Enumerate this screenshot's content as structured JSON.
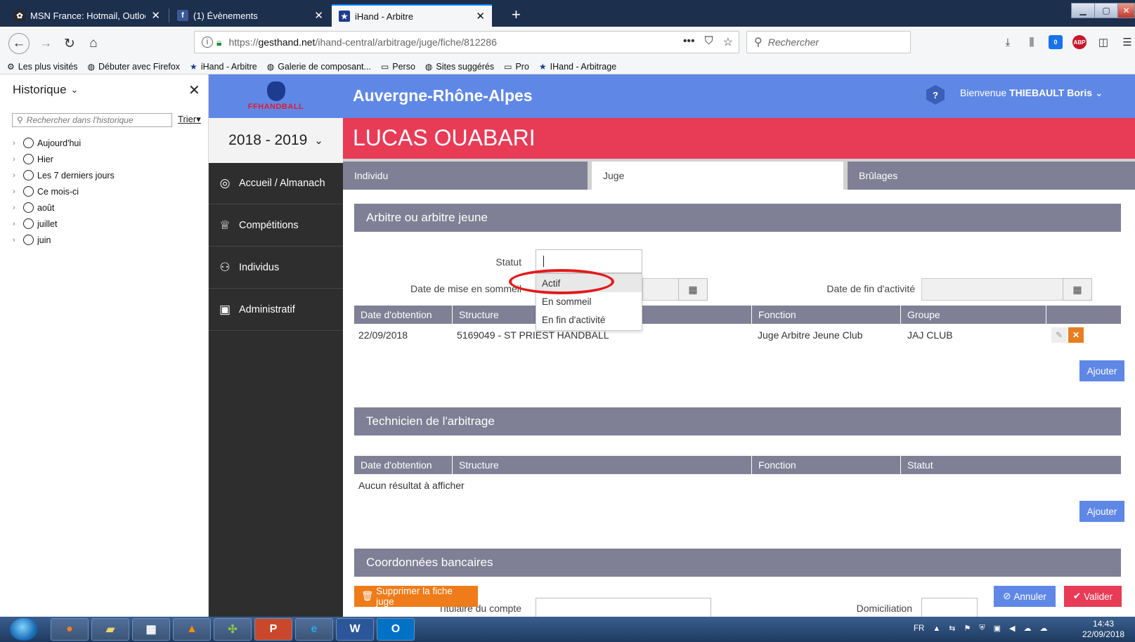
{
  "browser": {
    "tabs": [
      {
        "title": "MSN France: Hotmail, Outlook,",
        "favicon": "msn-butterfly-icon"
      },
      {
        "title": "(1) Évènements",
        "favicon": "facebook-icon"
      },
      {
        "title": "iHand - Arbitre",
        "favicon": "ffhandball-icon",
        "active": true
      }
    ],
    "url": {
      "protocol": "https://",
      "host": "gesthand.net",
      "path": "/ihand-central/arbitrage/juge/fiche/812286"
    },
    "search_placeholder": "Rechercher",
    "notification_count": "0",
    "adblock_label": "ABP",
    "bookmarks": [
      {
        "label": "Les plus visités",
        "icon": "gear-icon"
      },
      {
        "label": "Débuter avec Firefox",
        "icon": "globe-icon"
      },
      {
        "label": "iHand - Arbitre",
        "icon": "ffhandball-icon"
      },
      {
        "label": "Galerie de composant...",
        "icon": "globe-icon"
      },
      {
        "label": "Perso",
        "icon": "folder-icon"
      },
      {
        "label": "Sites suggérés",
        "icon": "globe-icon"
      },
      {
        "label": "Pro",
        "icon": "folder-icon"
      },
      {
        "label": "IHand - Arbitrage",
        "icon": "ffhandball-icon"
      }
    ]
  },
  "history": {
    "title": "Historique",
    "search_placeholder": "Rechercher dans l'historique",
    "sort_label": "Trier",
    "items": [
      "Aujourd'hui",
      "Hier",
      "Les 7 derniers jours",
      "Ce mois-ci",
      "août",
      "juillet",
      "juin"
    ]
  },
  "app": {
    "logo_text": "FFHANDBALL",
    "season": "2018 - 2019",
    "nav": [
      {
        "label": "Accueil / Almanach",
        "icon": "compass-icon"
      },
      {
        "label": "Compétitions",
        "icon": "trophy-icon"
      },
      {
        "label": "Individus",
        "icon": "user-icon"
      },
      {
        "label": "Administratif",
        "icon": "briefcase-icon"
      }
    ],
    "region": "Auvergne-Rhône-Alpes",
    "help_label": "?",
    "welcome_prefix": "Bienvenue",
    "welcome_user": "THIEBAULT Boris",
    "person_name": "LUCAS OUABARI",
    "tabs": [
      "Individu",
      "Juge",
      "Brûlages"
    ],
    "active_tab": "Juge"
  },
  "form": {
    "section1_title": "Arbitre ou arbitre jeune",
    "statut_label": "Statut",
    "statut_value": "",
    "statut_options": [
      "Actif",
      "En sommeil",
      "En fin d'activité"
    ],
    "date_sommeil_label": "Date de mise en sommeil",
    "date_fin_label": "Date de fin d'activité",
    "table1": {
      "headers": [
        "Date d'obtention",
        "Structure",
        "Fonction",
        "Groupe"
      ],
      "rows": [
        {
          "date": "22/09/2018",
          "structure": "5169049 - ST PRIEST HANDBALL",
          "fonction": "Juge Arbitre Jeune Club",
          "groupe": "JAJ CLUB"
        }
      ]
    },
    "add_label": "Ajouter",
    "section2_title": "Technicien de l'arbitrage",
    "table2": {
      "headers": [
        "Date d'obtention",
        "Structure",
        "Fonction",
        "Statut"
      ],
      "empty": "Aucun résultat à afficher"
    },
    "section3_title": "Coordonnées bancaires",
    "titulaire_label": "Titulaire du compte",
    "domiciliation_label": "Domiciliation",
    "delete_label": "Supprimer la fiche juge",
    "cancel_label": "Annuler",
    "validate_label": "Valider"
  },
  "taskbar": {
    "apps": [
      "firefox-icon",
      "explorer-icon",
      "calculator-icon",
      "vlc-icon",
      "app-icon",
      "powerpoint-icon",
      "ie-icon",
      "word-icon",
      "outlook-icon"
    ],
    "lang": "FR",
    "time": "14:43",
    "date": "22/09/2018"
  },
  "colors": {
    "brand_blue": "#5f88e6",
    "brand_red": "#e83b56",
    "section_grey": "#7f7f95",
    "nav_dark": "#2e2e2e",
    "orange": "#ee7c1a",
    "highlight_ring": "#e21a1a"
  }
}
